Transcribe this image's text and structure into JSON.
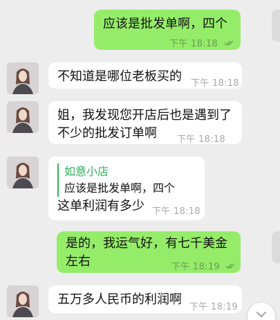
{
  "colors": {
    "background": "#ededed",
    "incoming_bubble": "#ffffff",
    "outgoing_bubble": "#95ec69",
    "quote_accent": "#2fb25c",
    "timestamp": "#a8a8a8"
  },
  "messages": [
    {
      "direction": "out",
      "text": "应该是批发单啊，四个",
      "time": "下午 18:18",
      "read_icon": "double-check-icon"
    },
    {
      "direction": "in",
      "text": "不知道是哪位老板买的",
      "time": "下午 18:18"
    },
    {
      "direction": "in",
      "text": "姐，我发现您开店后也是遇到了不少的批发订单啊",
      "time": "下午 18:18"
    },
    {
      "direction": "in",
      "quote": {
        "name": "如意小店",
        "text": "应该是批发单啊，四个"
      },
      "text": "这单利润有多少",
      "time": "下午 18:18"
    },
    {
      "direction": "out",
      "text": "是的，我运气好，有七千美金左右",
      "time": "下午 18:19",
      "read_icon": "double-check-icon"
    },
    {
      "direction": "in",
      "text": "五万多人民币的利润啊",
      "time": "下午 18:19"
    }
  ],
  "scroll_button": {
    "icon": "chevron-down-icon"
  }
}
